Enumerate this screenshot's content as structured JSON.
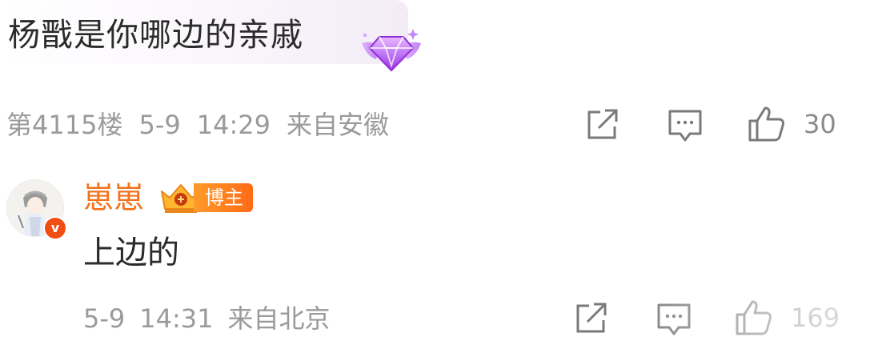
{
  "top_comment": {
    "text": "杨戬是你哪边的亲戚",
    "badge_icon": "purple-diamond-badge-icon",
    "meta": {
      "floor": "第4115楼",
      "date": "5-9",
      "time": "14:29",
      "location": "来自安徽"
    },
    "actions": {
      "share_icon": "share-icon",
      "comment_icon": "comment-icon",
      "like_icon": "thumbs-up-icon",
      "like_count": "30"
    }
  },
  "reply": {
    "username": "崽崽",
    "avatar_icon": "avatar-image",
    "verified_badge": "v",
    "owner_tag": "博主",
    "text": "上边的",
    "meta": {
      "date": "5-9",
      "time": "14:31",
      "location": "来自北京"
    },
    "actions": {
      "like_count": "169"
    }
  },
  "colors": {
    "username": "#f2731d",
    "meta_gray": "#9a9a9a",
    "badge_purple": "#b85cf0",
    "owner_tag": "#ff7a1e"
  }
}
